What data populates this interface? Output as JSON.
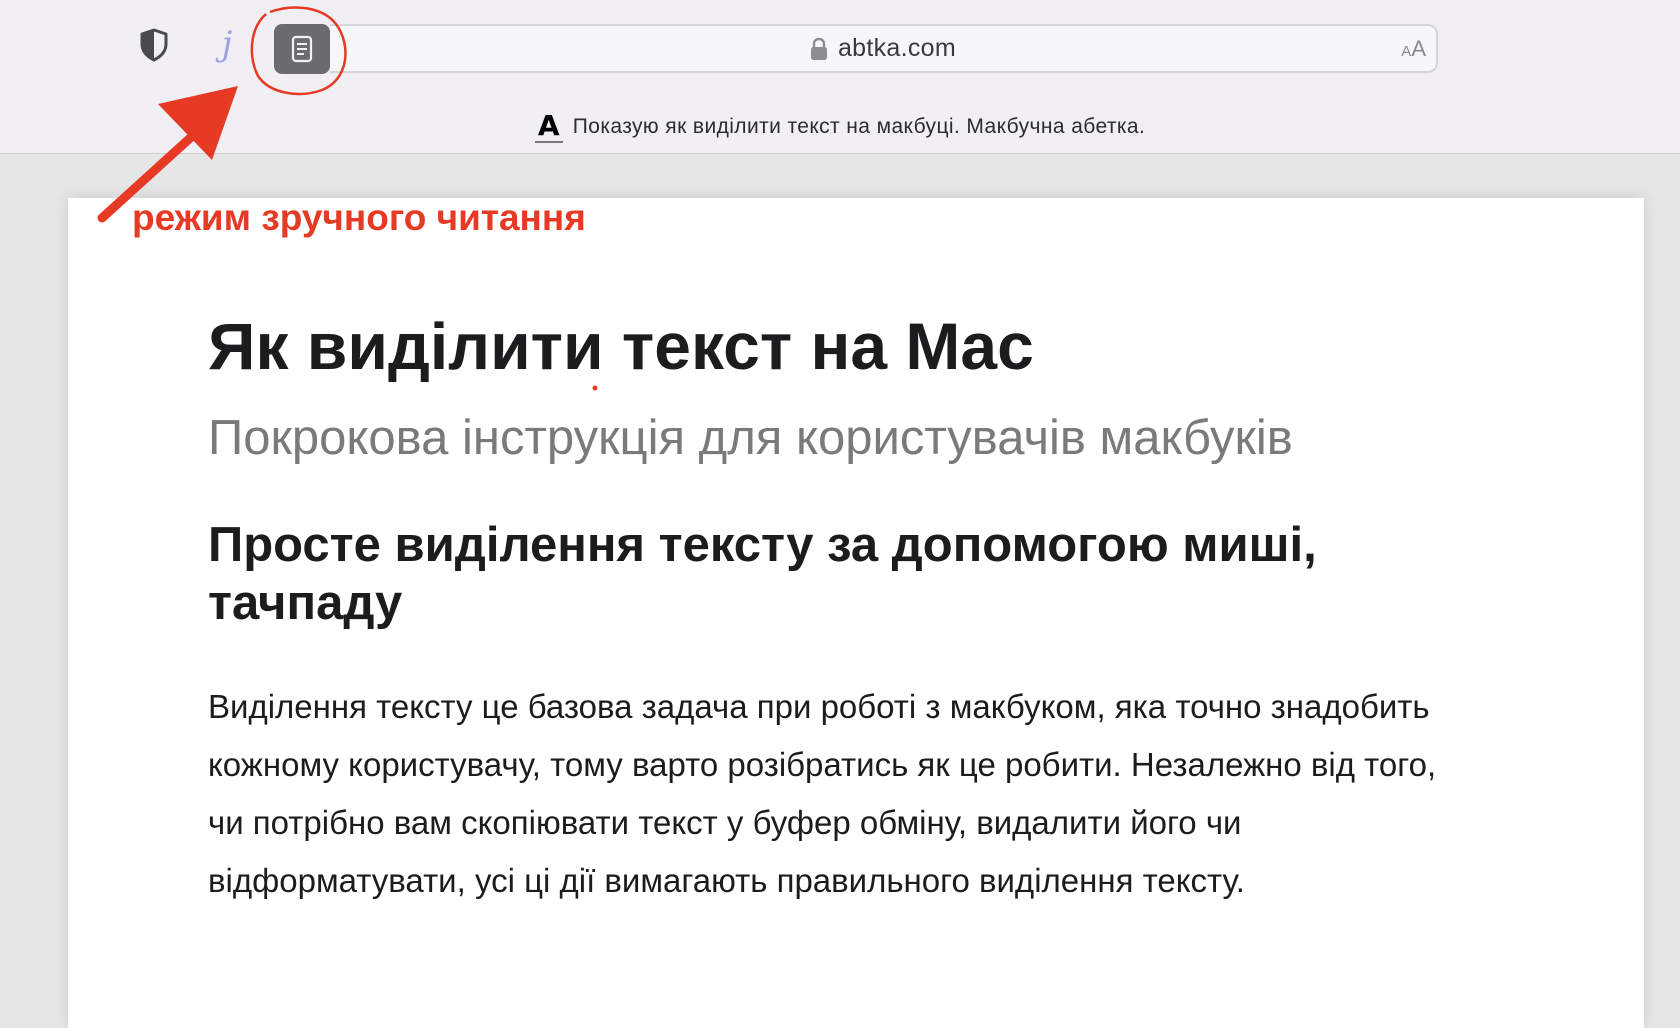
{
  "toolbar": {
    "extension_glyph": "j",
    "address": "abtka.com",
    "text_size_small": "A",
    "text_size_large": "A",
    "favicon_letter": "A",
    "tab_title": "Показую як виділити текст на макбуці. Макбучна абетка."
  },
  "article": {
    "title": "Як виділити текст на Mac",
    "subtitle": "Покрокова інструкція для користувачів макбуків",
    "heading": "Просте виділення тексту за допомогою миші, тачпаду",
    "paragraph": "Виділення тексту це базова задача при роботі з макбуком, яка точно знадобить кожному користувачу, тому варто розібратись як це робити. Незалежно від того, чи потрібно вам скопіювати текст у буфер обміну, видалити його чи відформатувати, усі ці дії вимагають правильного виділення тексту."
  },
  "annotation": {
    "label": "режим зручного читання",
    "color": "#e63a25"
  },
  "colors": {
    "toolbar_bg": "#f1eff4",
    "reader_button": "#6c6b70",
    "page_bg": "#e6e6e6",
    "article_bg": "#ffffff"
  },
  "icons": {
    "privacy": "shield-icon",
    "reader": "reader-mode-icon",
    "lock": "lock-icon"
  }
}
